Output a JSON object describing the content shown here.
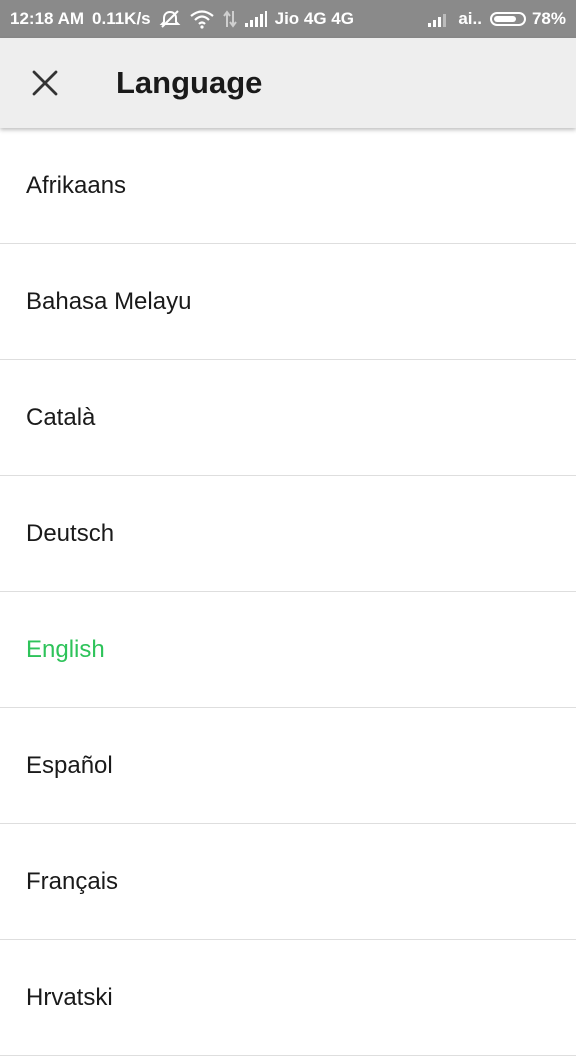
{
  "status_bar": {
    "time": "12:18 AM",
    "speed": "0.11K/s",
    "carrier": "Jio 4G 4G",
    "carrier2": "ai..",
    "battery_text": "78%",
    "battery_level": 0.78,
    "icons": [
      "mute-icon",
      "wifi-icon",
      "data-arrows-icon",
      "signal-icon",
      "signal-icon",
      "battery-icon"
    ]
  },
  "app_bar": {
    "title": "Language",
    "close_icon": "close-icon"
  },
  "languages": [
    {
      "label": "Afrikaans",
      "selected": false
    },
    {
      "label": "Bahasa Melayu",
      "selected": false
    },
    {
      "label": "Català",
      "selected": false
    },
    {
      "label": "Deutsch",
      "selected": false
    },
    {
      "label": "English",
      "selected": true
    },
    {
      "label": "Español",
      "selected": false
    },
    {
      "label": "Français",
      "selected": false
    },
    {
      "label": "Hrvatski",
      "selected": false
    }
  ],
  "colors": {
    "status_bar_bg": "#8a8a8a",
    "app_bar_bg": "#eeeeee",
    "selected_accent": "#2ec35a",
    "divider": "#dedede"
  }
}
